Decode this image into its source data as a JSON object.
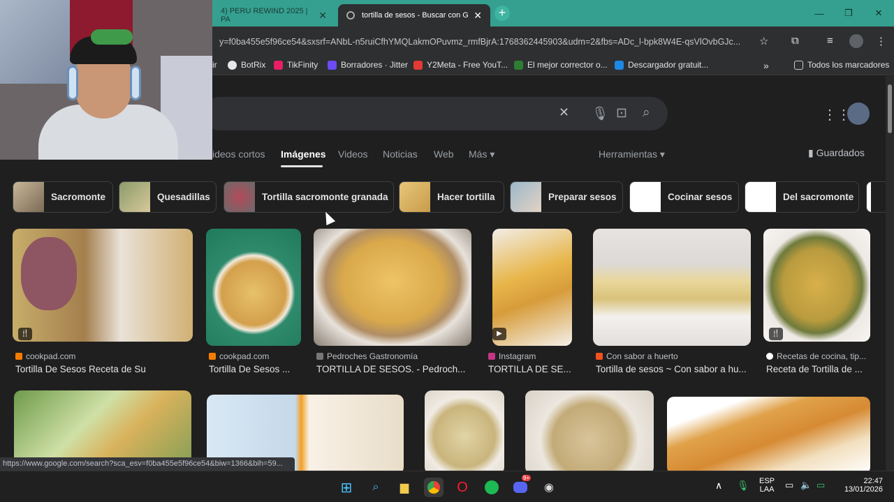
{
  "tabs": {
    "inactive_label": "4) PERU REWIND 2025 | PA",
    "active_label": "tortilla de sesos - Buscar con G",
    "new_tab": "+",
    "close": "✕"
  },
  "window_controls": {
    "minimize": "—",
    "restore": "❐",
    "close": "✕"
  },
  "address_bar": {
    "url": "y=f0ba455e5f96ce54&sxsrf=ANbL-n5ruiCfhYMQLakmOPuvmz_rmfBjrA:1768362445903&udm=2&fbs=ADc_l-bpk8W4E-qsVlOvbGJc..."
  },
  "bookmarks": [
    {
      "label": "BotRix",
      "color": "#e8e8e8"
    },
    {
      "label": "TikFinity",
      "color": "#e91e63"
    },
    {
      "label": "Borradores · Jitter",
      "color": "#6c4cf5"
    },
    {
      "label": "Y2Meta - Free YouT...",
      "color": "#e53935"
    },
    {
      "label": "El mejor corrector o...",
      "color": "#2e7d32"
    },
    {
      "label": "Descargador gratuit...",
      "color": "#1e88e5"
    }
  ],
  "bookmarks_overflow": "»",
  "bookmarks_all": "Todos los marcadores",
  "bookmark_partial": "ir",
  "search": {
    "clear": "✕"
  },
  "nav": {
    "tabs": [
      "ideos cortos",
      "Imágenes",
      "Videos",
      "Noticias",
      "Web",
      "Más ▾"
    ],
    "tools": "Herramientas ▾",
    "saved": "Guardados"
  },
  "chips": [
    "Sacromonte",
    "Quesadillas",
    "Tortilla sacromonte granada",
    "Hacer tortilla",
    "Preparar sesos",
    "Cocinar sesos",
    "Del sacromonte"
  ],
  "results_row1": [
    {
      "source": "cookpad.com",
      "title": "Tortilla De Sesos Receta de Su",
      "badge": "🍴",
      "src_color": "#f57c00"
    },
    {
      "source": "cookpad.com",
      "title": "Tortilla De Sesos ...",
      "badge": "",
      "src_color": "#f57c00"
    },
    {
      "source": "Pedroches Gastronomía",
      "title": "TORTILLA DE SESOS. - Pedroch...",
      "badge": "",
      "src_color": "#777"
    },
    {
      "source": "Instagram",
      "title": "TORTILLA DE SE...",
      "badge": "▶",
      "src_color": "#c13584"
    },
    {
      "source": "Con sabor a huerto",
      "title": "Tortilla de sesos ~ Con sabor a hu...",
      "badge": "",
      "src_color": "#f4511e"
    },
    {
      "source": "Recetas de cocina, tip...",
      "title": "Receta de Tortilla de ...",
      "badge": "🍴",
      "src_color": "#ffffff"
    }
  ],
  "status_url": "https://www.google.com/search?sca_esv=f0ba455e5f96ce54&biw=1366&bih=59...",
  "tray": {
    "lang_top": "ESP",
    "lang_bottom": "LAA",
    "time": "22:47",
    "date": "13/01/2026",
    "up_arrow": "∧",
    "discord_badge": "9+"
  }
}
